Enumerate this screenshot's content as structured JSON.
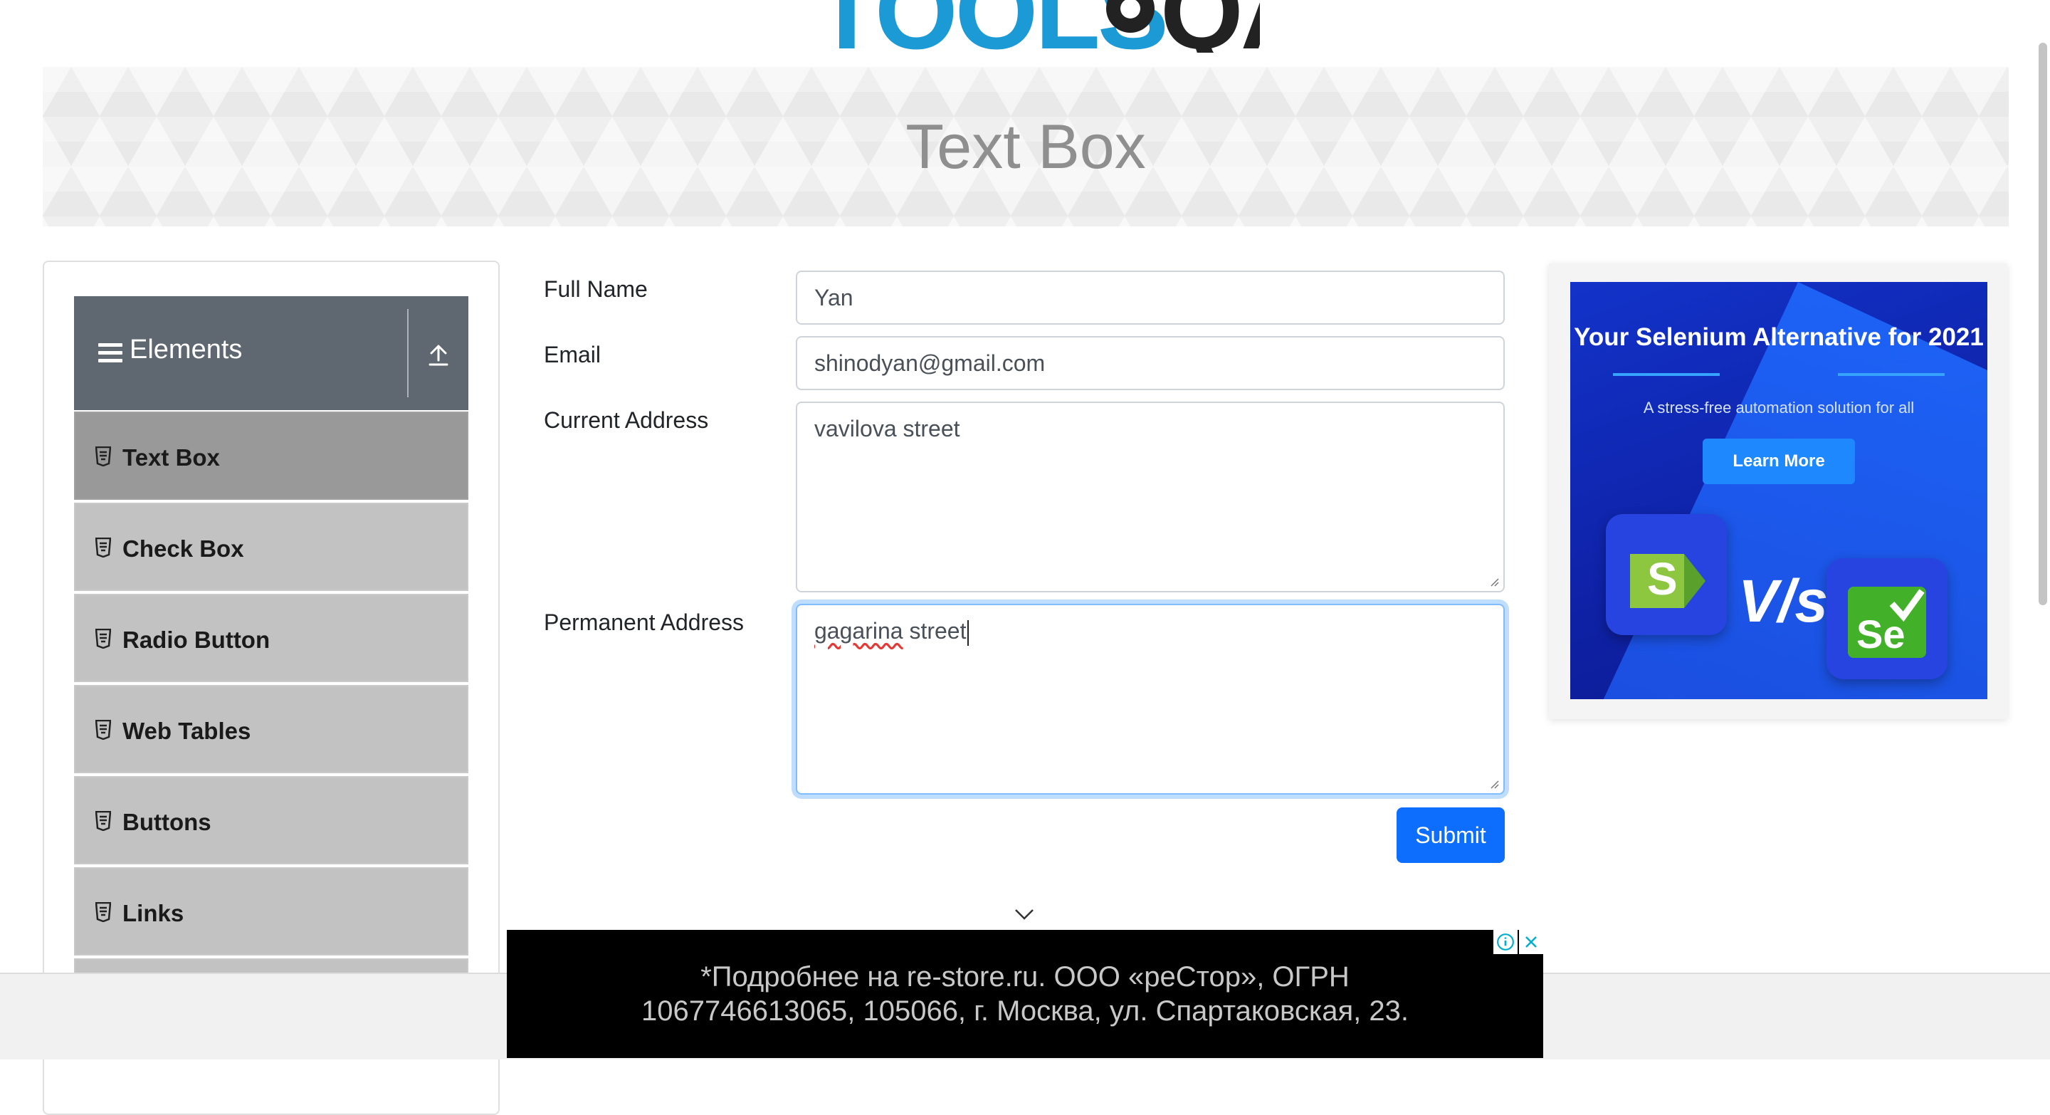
{
  "logo": {
    "text_left": "TOOLS",
    "text_right": "QA"
  },
  "banner": {
    "title": "Text Box"
  },
  "sidebar": {
    "group_title": "Elements",
    "items": [
      {
        "label": "Text Box",
        "active": true
      },
      {
        "label": "Check Box",
        "active": false
      },
      {
        "label": "Radio Button",
        "active": false
      },
      {
        "label": "Web Tables",
        "active": false
      },
      {
        "label": "Buttons",
        "active": false
      },
      {
        "label": "Links",
        "active": false
      }
    ]
  },
  "form": {
    "full_name_label": "Full Name",
    "full_name_value": "Yan",
    "email_label": "Email",
    "email_value": "shinodyan@gmail.com",
    "current_address_label": "Current Address",
    "current_address_value": "vavilova street",
    "permanent_address_label": "Permanent Address",
    "permanent_address_value_word1": "gagarina",
    "permanent_address_value_word2": " street",
    "submit_label": "Submit"
  },
  "right_ad": {
    "headline": "Your Selenium Alternative for 2021",
    "subline": "A stress-free automation solution for all",
    "cta": "Learn More",
    "left_logo": "S",
    "vs": "V/s",
    "right_logo": "Se"
  },
  "bottom_ad": {
    "line1": "*Подробнее на re-store.ru. ООО «реСтор», ОГРН",
    "line2": "1067746613065, 105066, г. Москва, ул. Спартаковская, 23."
  },
  "colors": {
    "primary": "#0d6efd",
    "sidebar_header": "#5f6870",
    "active_item": "#999999",
    "item": "#c2c2c2"
  }
}
